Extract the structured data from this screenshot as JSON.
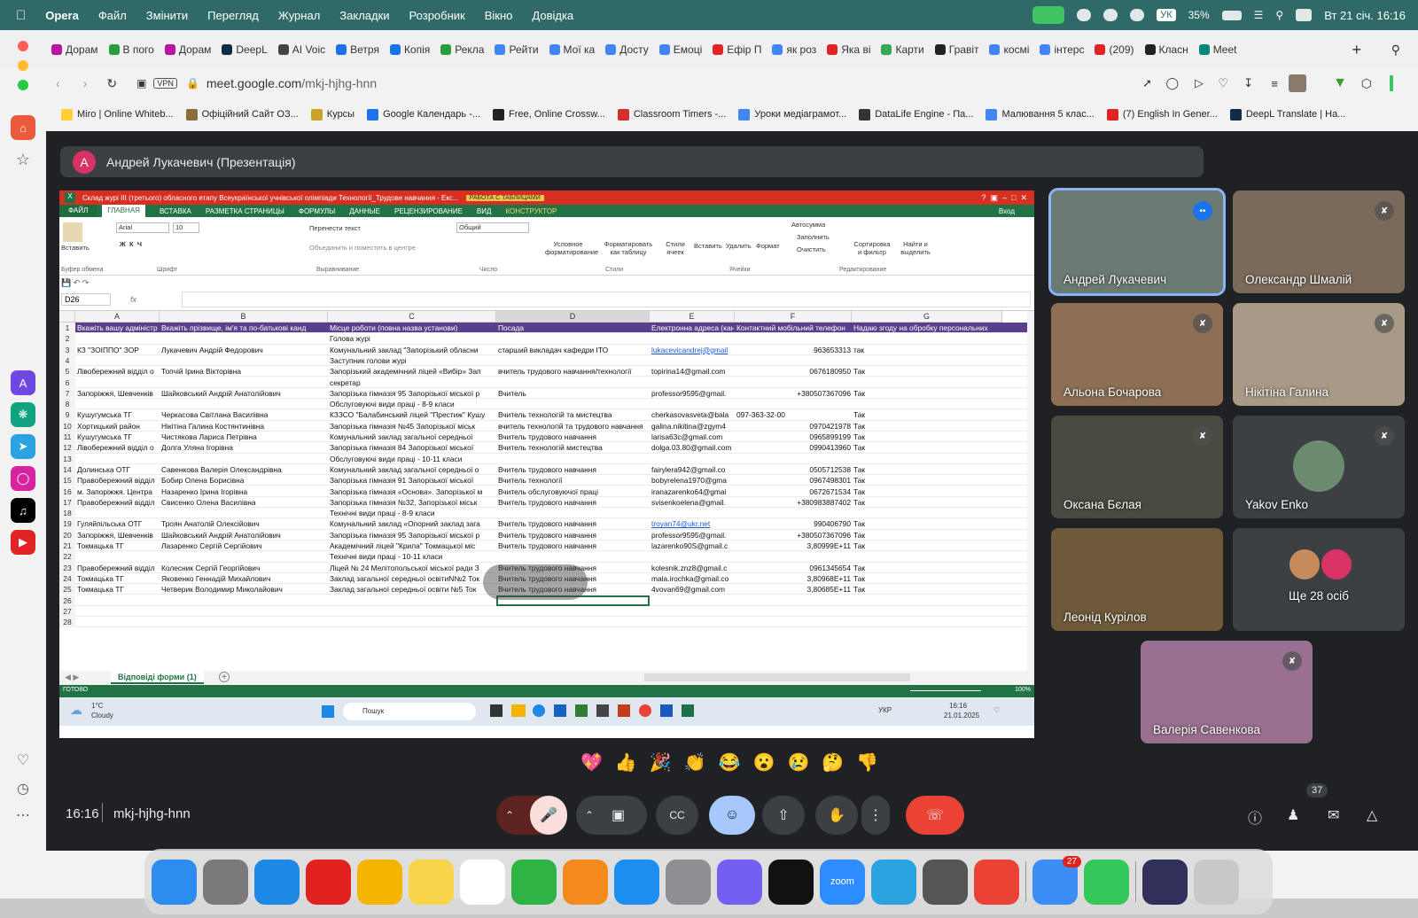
{
  "menubar": {
    "apple": "",
    "app": "Opera",
    "items": [
      "Файл",
      "Змінити",
      "Перегляд",
      "Журнал",
      "Закладки",
      "Розробник",
      "Вікно",
      "Довідка"
    ],
    "lang": "УК",
    "battery": "35%",
    "datetime": "Вт 21 січ.  16:16"
  },
  "tabs": [
    {
      "label": "Дорам",
      "color": "#b5179e"
    },
    {
      "label": "В пого",
      "color": "#2d9c3a"
    },
    {
      "label": "Дорам",
      "color": "#b5179e"
    },
    {
      "label": "DeepL",
      "color": "#0f2b46"
    },
    {
      "label": "AI Voic",
      "color": "#444"
    },
    {
      "label": "Ветря",
      "color": "#1a73e8"
    },
    {
      "label": "Копія",
      "color": "#1a73e8"
    },
    {
      "label": "Рекла",
      "color": "#2d9c3a"
    },
    {
      "label": "Рейти",
      "color": "#4285f4"
    },
    {
      "label": "Мої ка",
      "color": "#4285f4"
    },
    {
      "label": "Досту",
      "color": "#4285f4"
    },
    {
      "label": "Емоці",
      "color": "#4285f4"
    },
    {
      "label": "Ефір П",
      "color": "#e02424"
    },
    {
      "label": "як роз",
      "color": "#4285f4"
    },
    {
      "label": "Яка ві",
      "color": "#e02424"
    },
    {
      "label": "Карти",
      "color": "#34a853"
    },
    {
      "label": "Гравіт",
      "color": "#222"
    },
    {
      "label": "космі",
      "color": "#4285f4"
    },
    {
      "label": "інтерс",
      "color": "#4285f4"
    },
    {
      "label": "(209)",
      "color": "#e02424"
    },
    {
      "label": "Класн",
      "color": "#222"
    },
    {
      "label": "Meet",
      "color": "#00897b"
    }
  ],
  "address": {
    "url_host": "meet.google.com",
    "url_path": "/mkj-hjhg-hnn",
    "vpn": "VPN"
  },
  "bookmarks": [
    {
      "label": "Miro | Online Whiteb...",
      "color": "#ffd02f"
    },
    {
      "label": "Офіційний Сайт ОЗ...",
      "color": "#8a6d3b"
    },
    {
      "label": "Курсы",
      "color": "#c9a227"
    },
    {
      "label": "Google Календарь -...",
      "color": "#1a73e8"
    },
    {
      "label": "Free, Online Crossw...",
      "color": "#222"
    },
    {
      "label": "Classroom Timers -...",
      "color": "#d32f2f"
    },
    {
      "label": "Уроки медіаграмот...",
      "color": "#4285f4"
    },
    {
      "label": "DataLife Engine - Па...",
      "color": "#333"
    },
    {
      "label": "Малювання 5 клас...",
      "color": "#4285f4"
    },
    {
      "label": "(7) English In Gener...",
      "color": "#e02424"
    },
    {
      "label": "DeepL Translate | На...",
      "color": "#0f2b46"
    }
  ],
  "presenter": {
    "initial": "А",
    "label": "Андрей Лукачевич (Презентація)"
  },
  "excel": {
    "title": "Склад журі ІІІ (третього) обласного етапу Всеукраїнської учнівської олімпіади Технології_Трудове навчання - Екс...",
    "context_tab": "РАБОТА С ТАБЛИЦАМИ",
    "menu": [
      "ФАЙЛ",
      "ГЛАВНАЯ",
      "ВСТАВКА",
      "РАЗМЕТКА СТРАНИЦЫ",
      "ФОРМУЛЫ",
      "ДАННЫЕ",
      "РЕЦЕНЗИРОВАНИЕ",
      "ВИД",
      "КОНСТРУКТОР"
    ],
    "login": "Вход",
    "ribbon": {
      "paste": "Вставить",
      "clipboard": "Буфер обмена",
      "font_name": "Arial",
      "font_size": "10",
      "font_group": "Шрифт",
      "wrap": "Перенести текст",
      "merge": "Объединить и поместить в центре",
      "align_group": "Выравнивание",
      "number_format": "Общий",
      "number_group": "Число",
      "cond": "Условное форматирование",
      "as_table": "Форматировать как таблицу",
      "cell_styles": "Стили ячеек",
      "styles_group": "Стили",
      "insert": "Вставить",
      "delete": "Удалить",
      "format": "Формат",
      "cells_group": "Ячейки",
      "autosum": "Автосумма",
      "fill": "Заполнить",
      "clear": "Очистить",
      "sort": "Сортировка и фильтр",
      "find": "Найти и выделить",
      "edit_group": "Редактирование"
    },
    "namebox": "D26",
    "fx": "fx",
    "columns": [
      "A",
      "B",
      "C",
      "D",
      "E",
      "F",
      "G"
    ],
    "rows": [
      {
        "n": "1",
        "A": "Вкажіть вашу адміністр",
        "B": "Вкажіть прізвище,  ім'я та по-батькові канд",
        "C": "Місце роботи (повна назва установи)",
        "D": "Посада",
        "E": "Електронна адреса (кандид",
        "F": "Контактний мобільний телефон",
        "G": "Надаю згоду на обробку персональних"
      },
      {
        "n": "2",
        "C": "Голова журі"
      },
      {
        "n": "3",
        "A": "КЗ \"ЗОІППО\" ЗОР",
        "B": "Лукачевич Андрій Федорович",
        "C": "Комунальний заклад \"Запорізький обласни",
        "D": "старший викладач кафедри ІТО",
        "E": "lukacevicandrej@gmail",
        "F": "963653313",
        "G": "так"
      },
      {
        "n": "4",
        "C": "Заступник голови журі"
      },
      {
        "n": "5",
        "A": "Лівобережний відділ о",
        "B": "Топчій Ірина Вікторівна",
        "C": "Запорізький академічний ліцей «Вибір» Зап",
        "D": "вчитель трудового навчання/технології",
        "E": "topirina14@gmail.com",
        "F": "0676180950",
        "G": "Так"
      },
      {
        "n": "6",
        "C": "секретар"
      },
      {
        "n": "7",
        "A": "Запоріжжя, Шевченків",
        "B": "Шайковський Андрій Анатолійович",
        "C": "Запорізька гімназія 95 Запорізької міської р",
        "D": "Вчитель",
        "E": "professor9595@gmail.",
        "F": "+380507367096",
        "G": "Так"
      },
      {
        "n": "8",
        "C": "Обслуговуючі види праці - 8-9 класи"
      },
      {
        "n": "9",
        "A": "Кушугумська ТГ",
        "B": "Черкасова Світлана Василівна",
        "C": "КЗЗСО \"Балабинський ліцей \"Престиж\" Кушу",
        "D": "Вчитель технологій та мистецтва",
        "E": "cherkasovasveta@bala",
        "F": "097-363-32-00",
        "G": "Так"
      },
      {
        "n": "10",
        "A": "Хортицький район",
        "B": "Нікітіна Галина Костянтинівна",
        "C": "Запорізька гімназія №45 Запорізької міськ",
        "D": "вчитель технологій та трудового навчання",
        "E": "galina.nikitina@zgym4",
        "F": "0970421978",
        "G": "Так"
      },
      {
        "n": "11",
        "A": "Кушугумська ТГ",
        "B": "Чистякова Лариса Петрівна",
        "C": "Комунальний заклад загальної середньої",
        "D": "Вчитель трудового навчання",
        "E": "larisa63c@gmail.com",
        "F": "0965899199",
        "G": "Так"
      },
      {
        "n": "12",
        "A": "Лівобережний відділ о",
        "B": "Долга Уляна Ігорівна",
        "C": "Запорізька гімназія 84 Запорізької міської",
        "D": "Вчитель технологій мистецтва",
        "E": "dolga.03.80@gmail.com",
        "F": "0990413960",
        "G": "Так"
      },
      {
        "n": "13",
        "C": "Обслуговуючі види праці - 10-11 класи"
      },
      {
        "n": "14",
        "A": "Долинська ОТГ",
        "B": "Савенкова Валерія Олександрівна",
        "C": "Комунальний заклад загальної середньої о",
        "D": "Вчитель трудового навчання",
        "E": "fairylera942@gmail.co",
        "F": "0505712538",
        "G": "Так"
      },
      {
        "n": "15",
        "A": "Правобережний відділ",
        "B": "Бобир Олена Борисівна",
        "C": "Запорізька гімназія 91 Запорізької міської",
        "D": "Вчитель технології",
        "E": "bobyrelena1970@gma",
        "F": "0967498301",
        "G": "Так"
      },
      {
        "n": "16",
        "A": "м. Запоріжжя. Центра",
        "B": "Назаренко Ірина Ігорівна",
        "C": "Запорізька гімназія «Основа». Запорізької м",
        "D": "Вчитель обслуговуючої праці",
        "E": "iranazarenko64@gmai",
        "F": "0672671534",
        "G": "Так"
      },
      {
        "n": "17",
        "A": "Правобережний відділ",
        "B": "Свисенко Олена Василівна",
        "C": "Запорізька гімназія №32, Запорізької міськ",
        "D": "Вчитель трудового навчання",
        "E": "svisenkoelena@gmail.",
        "F": "+380983887402",
        "G": "Так"
      },
      {
        "n": "18",
        "C": "Технічні види праці - 8-9 класи"
      },
      {
        "n": "19",
        "A": "Гуляйпільська ОТГ",
        "B": "Троян Анатолій Олексійович",
        "C": "Комунальний заклад «Опорний заклад зага",
        "D": "Вчитель трудового навчання",
        "E": "troyan74@ukr.net",
        "F": "990406790",
        "G": "Так"
      },
      {
        "n": "20",
        "A": "Запоріжжя, Шевченків",
        "B": "Шайковський Андрій Анатолійович",
        "C": "Запорізька гімназія 95 Запорізької міської р",
        "D": "Вчитель трудового навчання",
        "E": "professor9595@gmail.",
        "F": "+380507367096",
        "G": "Так"
      },
      {
        "n": "21",
        "A": "Токмацька ТГ",
        "B": "Лазаренко Сергій Сергійович",
        "C": "Академічний ліцей \"Крила\" Токмацької міс",
        "D": "Вчитель трудового навчання",
        "E": "lazarenko90S@gmail.c",
        "F": "3,80999E+11",
        "G": "Так"
      },
      {
        "n": "22",
        "C": "Технічні види праці - 10-11 класи"
      },
      {
        "n": "23",
        "A": "Правобережний відділ",
        "B": "Колесник Сергій Георгійович",
        "C": "Ліцей № 24 Мелітопольської міської ради З",
        "D": "Вчитель трудового навчання",
        "E": "kolesnik.znz8@gmail.c",
        "F": "0961345654",
        "G": "Так"
      },
      {
        "n": "24",
        "A": "Токмацька ТГ",
        "B": "Яковенко Геннадій Михайлович",
        "C": "Заклад загальної середньої освітиN№2 Ток",
        "D": "Вчитель трудового навчання",
        "E": "mala.irochka@gmail.co",
        "F": "3,80968E+11",
        "G": "Так"
      },
      {
        "n": "25",
        "A": "Токмацька ТГ",
        "B": "Четверик Володимир Миколайович",
        "C": "Заклад загальної середньої освіти №5 Ток",
        "D": "Вчитель трудового навчання",
        "E": "4vovan69@gmail.com",
        "F": "3,80685E+11",
        "G": "Так"
      },
      {
        "n": "26"
      },
      {
        "n": "27"
      },
      {
        "n": "28"
      }
    ],
    "sheet_tab": "Відповіді форми (1)",
    "status": "ГОТОВО",
    "zoom": "100%",
    "taskbar": {
      "weather_temp": "1°C",
      "weather_desc": "Cloudy",
      "search": "Пошук",
      "lang": "УКР",
      "time": "16:16",
      "date": "21.01.2025"
    }
  },
  "participants": [
    {
      "name": "Андрей Лукачевич",
      "active": true,
      "muted": false,
      "bg": "#6b7a73"
    },
    {
      "name": "Олександр Шмалій",
      "active": false,
      "muted": true,
      "bg": "#7a6a5a"
    },
    {
      "name": "Альона Бочарова",
      "active": false,
      "muted": true,
      "bg": "#8c6f55"
    },
    {
      "name": "Нікітіна Галина",
      "active": false,
      "muted": true,
      "bg": "#a89a86"
    },
    {
      "name": "Оксана Бєлая",
      "active": false,
      "muted": true,
      "bg": "#4a4a40"
    },
    {
      "name": "Yakov Enko",
      "active": false,
      "muted": true,
      "bg": "#3c4043"
    },
    {
      "name": "Леонід Курілов",
      "active": false,
      "muted": false,
      "bg": "#6e5a3a"
    },
    {
      "name": "Ще 28 осіб",
      "active": false,
      "muted": false,
      "bg": "#3c4043"
    },
    {
      "name": "Валерія Савенкова",
      "active": false,
      "muted": true,
      "bg": "#9a7090"
    }
  ],
  "reactions": [
    "💖",
    "👍",
    "🎉",
    "👏",
    "😂",
    "😮",
    "😢",
    "🤔",
    "👎"
  ],
  "meeting": {
    "time": "16:16",
    "code": "mkj-hjhg-hnn",
    "people_count": "37"
  },
  "dock": [
    {
      "name": "finder",
      "color": "#2d8cf0"
    },
    {
      "name": "launchpad",
      "color": "#7a7a7a"
    },
    {
      "name": "safari",
      "color": "#1e88e5"
    },
    {
      "name": "opera",
      "color": "#e0211d"
    },
    {
      "name": "photos",
      "color": "#f4b400"
    },
    {
      "name": "notes",
      "color": "#f7d44a"
    },
    {
      "name": "freeform",
      "color": "#ffffff"
    },
    {
      "name": "numbers",
      "color": "#2fb344"
    },
    {
      "name": "pages",
      "color": "#f48a1e"
    },
    {
      "name": "app-store",
      "color": "#1c8ef0"
    },
    {
      "name": "settings",
      "color": "#8e8e93"
    },
    {
      "name": "viber",
      "color": "#7360f2"
    },
    {
      "name": "capcut",
      "color": "#111111"
    },
    {
      "name": "zoom",
      "color": "#2d8cff",
      "label": "zoom"
    },
    {
      "name": "telegram",
      "color": "#2aa3e0"
    },
    {
      "name": "iphone-mirroring",
      "color": "#555555"
    },
    {
      "name": "chrome",
      "color": "#ea4335"
    },
    {
      "name": "mail",
      "color": "#3a8ef6",
      "badge": "27"
    },
    {
      "name": "facetime",
      "color": "#34c759"
    },
    {
      "name": "wallpaper",
      "color": "#30305a"
    },
    {
      "name": "trash",
      "color": "#c8c8c8"
    }
  ]
}
